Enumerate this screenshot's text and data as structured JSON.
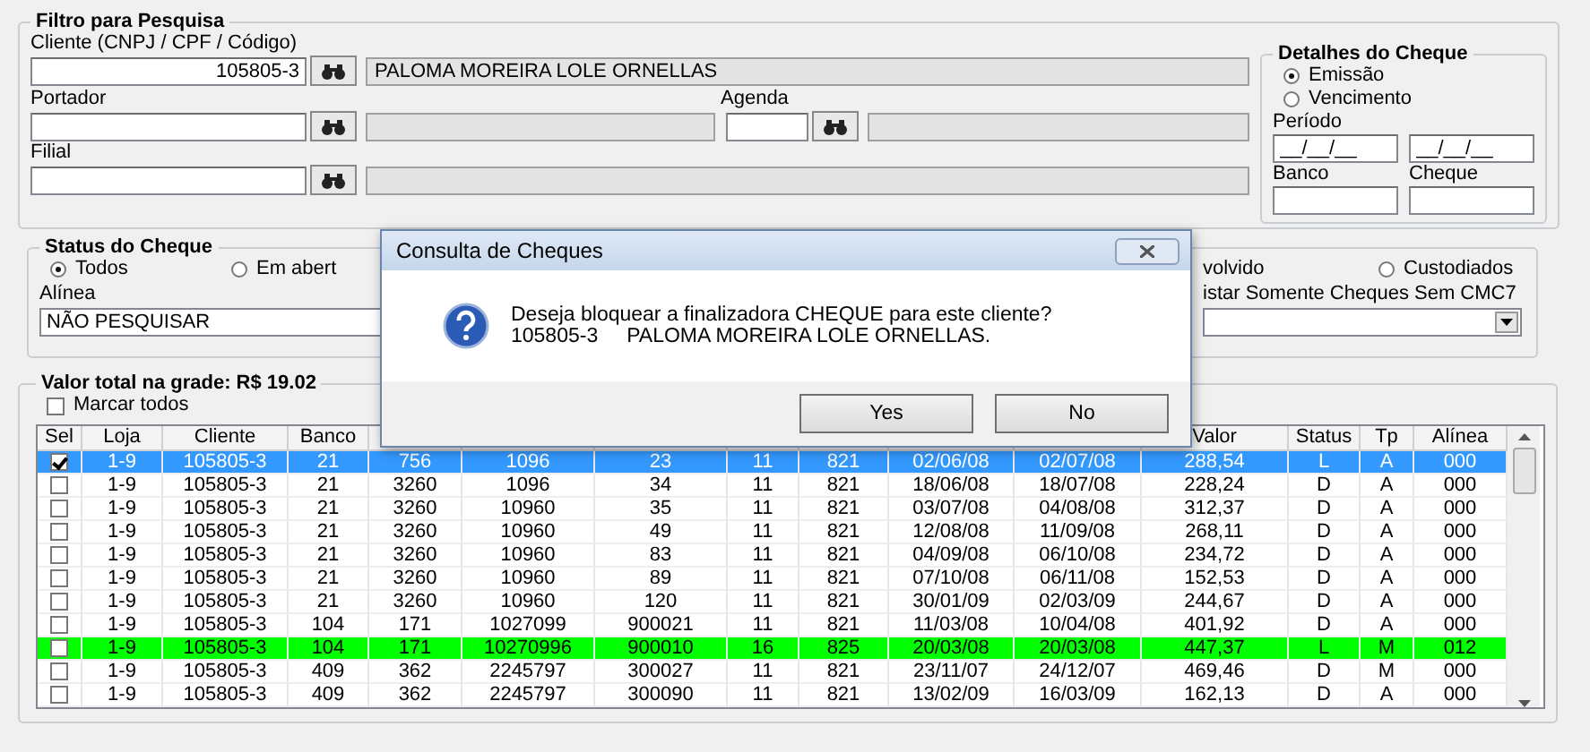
{
  "filter": {
    "title": "Filtro para Pesquisa",
    "cliente": {
      "label": "Cliente (CNPJ / CPF / Código)",
      "value": "105805-3",
      "name": "PALOMA MOREIRA LOLE ORNELLAS"
    },
    "portador": {
      "label": "Portador"
    },
    "agenda": {
      "label": "Agenda"
    },
    "filial": {
      "label": "Filial"
    }
  },
  "details": {
    "title": "Detalhes do Cheque",
    "date_type": [
      {
        "label": "Emissão",
        "selected": true
      },
      {
        "label": "Vencimento",
        "selected": false
      }
    ],
    "periodo": {
      "label": "Período",
      "from": "__/__/__",
      "to": "__/__/__"
    },
    "banco": {
      "label": "Banco"
    },
    "cheque": {
      "label": "Cheque"
    }
  },
  "status": {
    "title": "Status do Cheque",
    "options": [
      {
        "label": "Todos",
        "selected": true
      },
      {
        "label": "Em abert",
        "selected": false
      }
    ],
    "option_fragment": "volvido",
    "right_options": [
      {
        "label": "Custodiados",
        "selected": false
      }
    ],
    "alinea": {
      "label": "Alínea",
      "value": "NÃO PESQUISAR"
    },
    "cmc7": {
      "label": "istar Somente Cheques Sem CMC7"
    }
  },
  "grid": {
    "title": "Valor total na grade: R$ 19.02",
    "mark_all": {
      "label": "Marcar todos",
      "checked": false
    },
    "select_column_label": "Sel",
    "columns": [
      {
        "label": "Loja"
      },
      {
        "label": "Cliente"
      },
      {
        "label": "Banco"
      },
      {},
      {},
      {},
      {},
      {},
      {},
      {},
      {
        "label": "Valor"
      },
      {
        "label": "Status"
      },
      {
        "label": "Tp"
      },
      {
        "label": "Alínea"
      }
    ],
    "rows": [
      {
        "checked": true,
        "selected": true,
        "flagged": false,
        "cells": [
          "1-9",
          "105805-3",
          "21",
          "756",
          "1096",
          "23",
          "11",
          "821",
          "02/06/08",
          "02/07/08",
          "288,54",
          "L",
          "A",
          "000"
        ]
      },
      {
        "checked": false,
        "selected": false,
        "flagged": false,
        "cells": [
          "1-9",
          "105805-3",
          "21",
          "3260",
          "1096",
          "34",
          "11",
          "821",
          "18/06/08",
          "18/07/08",
          "228,24",
          "D",
          "A",
          "000"
        ]
      },
      {
        "checked": false,
        "selected": false,
        "flagged": false,
        "cells": [
          "1-9",
          "105805-3",
          "21",
          "3260",
          "10960",
          "35",
          "11",
          "821",
          "03/07/08",
          "04/08/08",
          "312,37",
          "D",
          "A",
          "000"
        ]
      },
      {
        "checked": false,
        "selected": false,
        "flagged": false,
        "cells": [
          "1-9",
          "105805-3",
          "21",
          "3260",
          "10960",
          "49",
          "11",
          "821",
          "12/08/08",
          "11/09/08",
          "268,11",
          "D",
          "A",
          "000"
        ]
      },
      {
        "checked": false,
        "selected": false,
        "flagged": false,
        "cells": [
          "1-9",
          "105805-3",
          "21",
          "3260",
          "10960",
          "83",
          "11",
          "821",
          "04/09/08",
          "06/10/08",
          "234,72",
          "D",
          "A",
          "000"
        ]
      },
      {
        "checked": false,
        "selected": false,
        "flagged": false,
        "cells": [
          "1-9",
          "105805-3",
          "21",
          "3260",
          "10960",
          "89",
          "11",
          "821",
          "07/10/08",
          "06/11/08",
          "152,53",
          "D",
          "A",
          "000"
        ]
      },
      {
        "checked": false,
        "selected": false,
        "flagged": false,
        "cells": [
          "1-9",
          "105805-3",
          "21",
          "3260",
          "10960",
          "120",
          "11",
          "821",
          "30/01/09",
          "02/03/09",
          "244,67",
          "D",
          "A",
          "000"
        ]
      },
      {
        "checked": false,
        "selected": false,
        "flagged": false,
        "cells": [
          "1-9",
          "105805-3",
          "104",
          "171",
          "1027099",
          "900021",
          "11",
          "821",
          "11/03/08",
          "10/04/08",
          "401,92",
          "D",
          "A",
          "000"
        ]
      },
      {
        "checked": false,
        "selected": false,
        "flagged": true,
        "cells": [
          "1-9",
          "105805-3",
          "104",
          "171",
          "10270996",
          "900010",
          "16",
          "825",
          "20/03/08",
          "20/03/08",
          "447,37",
          "L",
          "M",
          "012"
        ]
      },
      {
        "checked": false,
        "selected": false,
        "flagged": false,
        "cells": [
          "1-9",
          "105805-3",
          "409",
          "362",
          "2245797",
          "300027",
          "11",
          "821",
          "23/11/07",
          "24/12/07",
          "469,46",
          "D",
          "M",
          "000"
        ]
      },
      {
        "checked": false,
        "selected": false,
        "flagged": false,
        "cells": [
          "1-9",
          "105805-3",
          "409",
          "362",
          "2245797",
          "300090",
          "11",
          "821",
          "13/02/09",
          "16/03/09",
          "162,13",
          "D",
          "A",
          "000"
        ]
      }
    ]
  },
  "dialog": {
    "title": "Consulta de Cheques",
    "message": "Deseja bloquear a finalizadora CHEQUE para este cliente?",
    "detail": "105805-3     PALOMA MOREIRA LOLE ORNELLAS.",
    "buttons": [
      "Yes",
      "No"
    ]
  }
}
